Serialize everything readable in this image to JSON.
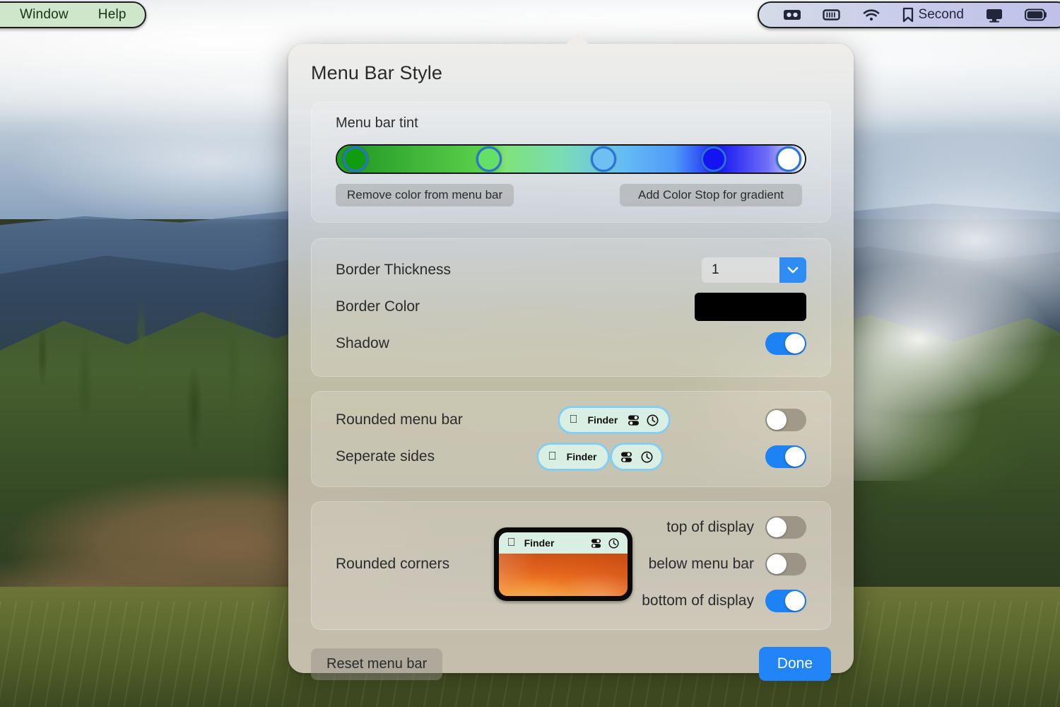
{
  "menu_bar": {
    "left_items": [
      {
        "label": "Window",
        "name": "menu-window"
      },
      {
        "label": "Help",
        "name": "menu-help"
      }
    ],
    "right_items": [
      {
        "icon": "screen-recorder-icon",
        "label": ""
      },
      {
        "icon": "battery-stripes-icon",
        "label": ""
      },
      {
        "icon": "wifi-icon",
        "label": ""
      },
      {
        "icon": "bookmark-icon",
        "label": "Second"
      },
      {
        "icon": "display-icon",
        "label": ""
      },
      {
        "icon": "battery-icon",
        "label": ""
      }
    ],
    "second_label": "Second",
    "left_bg": "#cfe6cb",
    "right_bg": "#c7c9ea"
  },
  "popover": {
    "title": "Menu Bar Style",
    "tint": {
      "label": "Menu bar tint",
      "gradient_css": "linear-gradient(90deg, #17a017 0%, #2aa02a 6%, #5fd44f 33%, #7fe27a 36%, #79dcb4 48%, #6ec7e0 57%, #63b9f5 62%, #4f9bf8 72%, #1a1ef0 82%, #2b2bf2 84%, #6f6ff8 92%, #ffffff 100%)",
      "stops": [
        {
          "name": "stop-1",
          "position_pct": 4,
          "color": "#0f9c0f"
        },
        {
          "name": "stop-2",
          "position_pct": 32.5,
          "color": "#64e065"
        },
        {
          "name": "stop-3",
          "position_pct": 57,
          "color": "#6fc0f2"
        },
        {
          "name": "stop-4",
          "position_pct": 80.5,
          "color": "#1414f0"
        },
        {
          "name": "stop-5",
          "position_pct": 96.5,
          "color": "#ffffff"
        }
      ],
      "remove_button": "Remove color from menu bar",
      "add_button": "Add Color Stop for gradient"
    },
    "border": {
      "thickness_label": "Border Thickness",
      "thickness_value": "1",
      "color_label": "Border Color",
      "color_value": "#000000",
      "shadow_label": "Shadow",
      "shadow_on": "on"
    },
    "rounded": {
      "rounded_menu_bar_label": "Rounded menu bar",
      "rounded_menu_bar_on": "off",
      "separate_sides_label": "Seperate sides",
      "separate_sides_on": "on",
      "preview_app_name": "Finder"
    },
    "corners": {
      "label": "Rounded corners",
      "preview_app_name": "Finder",
      "options": [
        {
          "label": "top of display",
          "state": "off",
          "name": "toggle-top-of-display"
        },
        {
          "label": "below menu bar",
          "state": "off",
          "name": "toggle-below-menu-bar"
        },
        {
          "label": "bottom of display",
          "state": "on",
          "name": "toggle-bottom-of-display"
        }
      ]
    },
    "footer": {
      "reset_label": "Reset menu bar",
      "done_label": "Done",
      "done_color": "#2285f7"
    }
  }
}
